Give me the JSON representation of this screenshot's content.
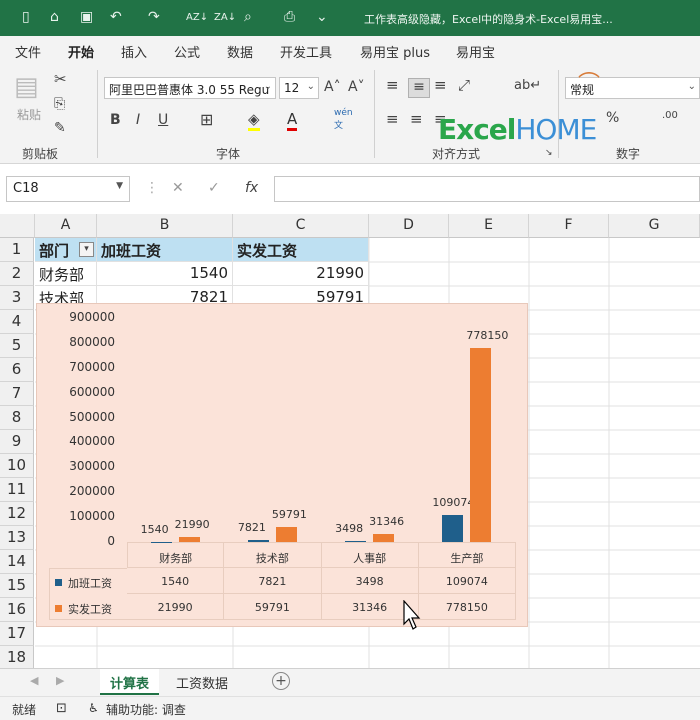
{
  "window": {
    "title": "工作表高级隐藏，Excel中的隐身术-Excel易用宝...",
    "quick_access": [
      "▯",
      "⌂",
      "▣",
      "↶",
      "↷",
      "AZ",
      "AZ",
      "⌕",
      "⎙",
      "⌄"
    ]
  },
  "menu": {
    "tabs": [
      "文件",
      "开始",
      "插入",
      "公式",
      "数据",
      "开发工具",
      "易用宝 plus",
      "易用宝"
    ],
    "active_tab": "开始"
  },
  "ribbon": {
    "clipboard": {
      "paste_label": "粘贴",
      "group_label": "剪贴板"
    },
    "font": {
      "font_name": "阿里巴巴普惠体 3.0 55 Regu",
      "font_size": "12",
      "bold": "B",
      "italic": "I",
      "underline": "U",
      "group_label": "字体"
    },
    "alignment": {
      "group_label": "对齐方式"
    },
    "number": {
      "format": "常规",
      "group_label": "数字"
    },
    "logo": {
      "excel": "Excel",
      "home": "HOME"
    }
  },
  "formula_bar": {
    "name_box": "C18",
    "cancel": "✕",
    "enter": "✓",
    "fx": "fx",
    "content": ""
  },
  "columns": [
    "A",
    "B",
    "C",
    "D",
    "E",
    "F",
    "G"
  ],
  "rows": [
    "1",
    "2",
    "3",
    "4",
    "5",
    "6",
    "7",
    "8",
    "9",
    "10",
    "11",
    "12",
    "13",
    "14",
    "15",
    "16",
    "17",
    "18"
  ],
  "table": {
    "headers": [
      "部门",
      "加班工资",
      "实发工资"
    ],
    "rows": [
      [
        "财务部",
        "1540",
        "21990"
      ],
      [
        "技术部",
        "7821",
        "59791"
      ]
    ]
  },
  "chart_data": {
    "type": "bar",
    "categories": [
      "财务部",
      "技术部",
      "人事部",
      "生产部"
    ],
    "series": [
      {
        "name": "加班工资",
        "values": [
          1540,
          7821,
          3498,
          109074
        ],
        "color": "#1f5f8b"
      },
      {
        "name": "实发工资",
        "values": [
          21990,
          59791,
          31346,
          778150
        ],
        "color": "#ed7d31"
      }
    ],
    "y_ticks": [
      "900000",
      "800000",
      "700000",
      "600000",
      "500000",
      "400000",
      "300000",
      "200000",
      "100000",
      "0"
    ],
    "ylim": [
      0,
      900000
    ],
    "data_table": true,
    "background": "#fbe3d9"
  },
  "sheets": {
    "tabs": [
      "计算表",
      "工资数据"
    ],
    "active": "计算表",
    "add": "+"
  },
  "status": {
    "ready": "就绪",
    "accessibility": "辅助功能: 调查"
  }
}
